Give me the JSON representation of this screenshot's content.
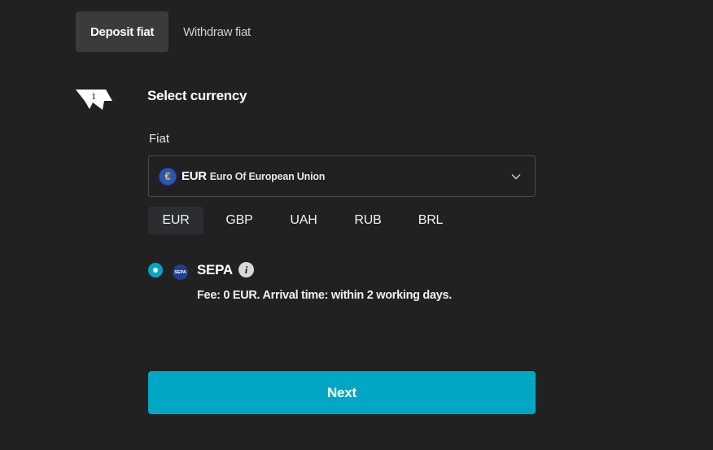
{
  "tabs": [
    {
      "label": "Deposit fiat",
      "active": true
    },
    {
      "label": "Withdraw fiat",
      "active": false
    }
  ],
  "step": {
    "number": "1",
    "title": "Select currency"
  },
  "fiat": {
    "label": "Fiat",
    "selected_code": "EUR",
    "selected_name": "Euro Of European Union",
    "selected_icon": "euro-icon",
    "quick_currencies": [
      "EUR",
      "GBP",
      "UAH",
      "RUB",
      "BRL"
    ],
    "active_quick": "EUR"
  },
  "payment_method": {
    "name": "SEPA",
    "logo_text": "SEPA",
    "selected": true,
    "description": "Fee: 0 EUR. Arrival time: within 2 working days."
  },
  "actions": {
    "next_label": "Next"
  },
  "colors": {
    "accent": "#00a7c4",
    "background": "#212121",
    "tab_active": "#3b3b3b"
  }
}
